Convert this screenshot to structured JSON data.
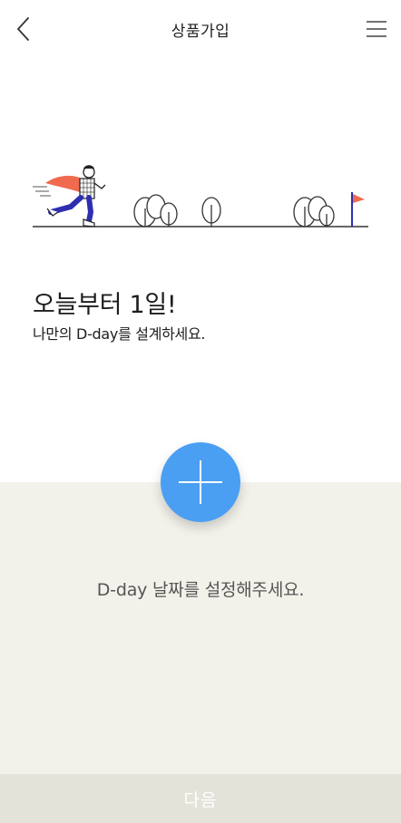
{
  "header": {
    "title": "상품가입",
    "back_icon": "chevron-left-icon",
    "menu_icon": "hamburger-menu-icon"
  },
  "intro": {
    "headline": "오늘부터 1일!",
    "subline": "나만의 D-day를 설계하세요."
  },
  "dday": {
    "add_icon": "plus-icon",
    "prompt": "D-day 날짜를 설정해주세요."
  },
  "footer": {
    "next_label": "다음"
  },
  "colors": {
    "accent": "#4a9ff2",
    "panel_bg": "#f2f1ea",
    "next_bar_bg": "#e4e3da",
    "cape": "#f06a4f",
    "flag": "#f06a4f"
  }
}
